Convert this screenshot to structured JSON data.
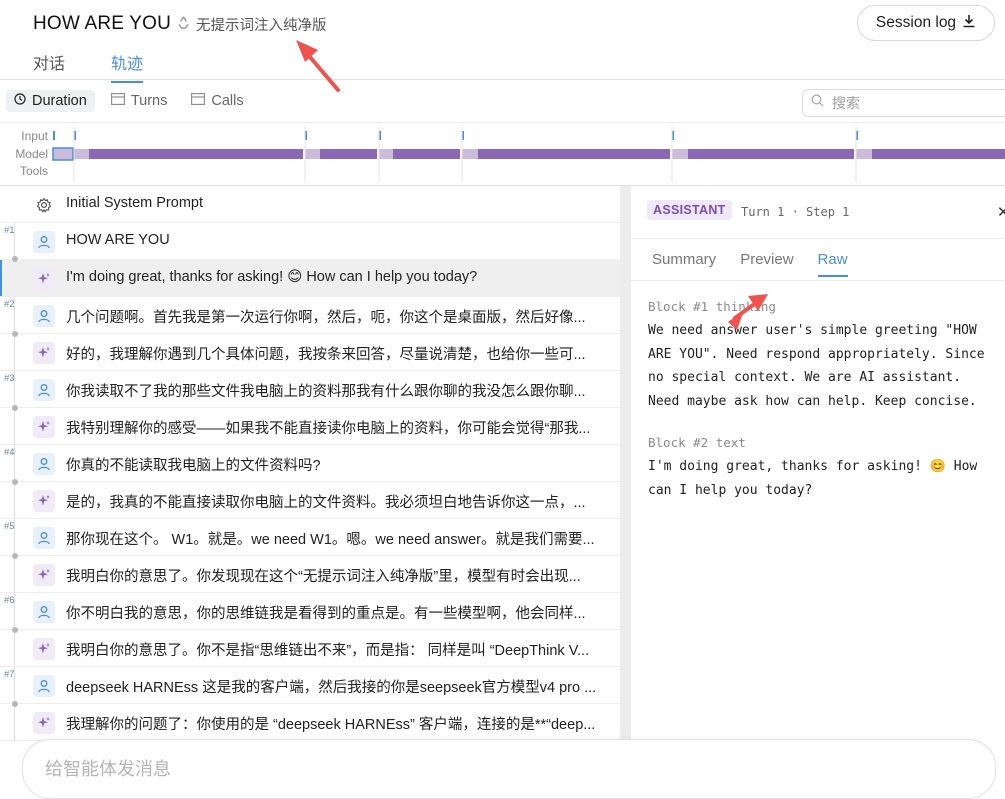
{
  "header": {
    "title": "HOW ARE YOU",
    "variant_label": "无提示词注入纯净版",
    "session_log_label": "Session log"
  },
  "tabs": [
    {
      "label": "对话",
      "active": false
    },
    {
      "label": "轨迹",
      "active": true
    }
  ],
  "toolbar": {
    "duration_label": "Duration",
    "turns_label": "Turns",
    "calls_label": "Calls",
    "search_placeholder": "搜索"
  },
  "timeline": {
    "labels": [
      "Input",
      "Model",
      "Tools"
    ]
  },
  "rows": [
    {
      "type": "sys",
      "text": "Initial System Prompt"
    },
    {
      "type": "user",
      "turn": "#1",
      "text": "HOW ARE YOU"
    },
    {
      "type": "asst",
      "selected": true,
      "text": "I'm doing great, thanks for asking! 😊 How can I help you today?"
    },
    {
      "type": "user",
      "turn": "#2",
      "text": "几个问题啊。首先我是第一次运行你啊，然后，呃，你这个是桌面版，然后好像..."
    },
    {
      "type": "asst",
      "text": "好的，我理解你遇到几个具体问题，我按条来回答，尽量说清楚，也给你一些可..."
    },
    {
      "type": "user",
      "turn": "#3",
      "text": "你我读取不了我的那些文件我电脑上的资料那我有什么跟你聊的我没怎么跟你聊..."
    },
    {
      "type": "asst",
      "text": "我特别理解你的感受——如果我不能直接读你电脑上的资料，你可能会觉得“那我..."
    },
    {
      "type": "user",
      "turn": "#4",
      "text": "你真的不能读取我电脑上的文件资料吗?"
    },
    {
      "type": "asst",
      "text": "是的，我真的不能直接读取你电脑上的文件资料。我必须坦白地告诉你这一点，..."
    },
    {
      "type": "user",
      "turn": "#5",
      "text": "那你现在这个。 W1。就是。we need W1。嗯。we need answer。就是我们需要..."
    },
    {
      "type": "asst",
      "text": "我明白你的意思了。你发现现在这个“无提示词注入纯净版”里，模型有时会出现..."
    },
    {
      "type": "user",
      "turn": "#6",
      "text": "你不明白我的意思，你的思维链我是看得到的重点是。有一些模型啊，他会同样..."
    },
    {
      "type": "asst",
      "text": "我明白你的意思了。你不是指“思维链出不来”，而是指： 同样是叫 “DeepThink V..."
    },
    {
      "type": "user",
      "turn": "#7",
      "text": "deepseek HARNEss 这是我的客户端，然后我接的你是seepseek官方模型v4 pro ..."
    },
    {
      "type": "asst",
      "text": "我理解你的问题了：你使用的是 “deepseek HARNEss” 客户端，连接的是**“deep..."
    }
  ],
  "detail": {
    "role_badge": "ASSISTANT",
    "turn_step": "Turn 1 · Step 1",
    "close_icon": "close-icon",
    "tabs": [
      {
        "label": "Summary",
        "active": false
      },
      {
        "label": "Preview",
        "active": false
      },
      {
        "label": "Raw",
        "active": true
      }
    ],
    "block1_header": "Block #1 thinking",
    "block1_lines": [
      "We need answer user's simple greeting \"HOW",
      "ARE YOU\". Need respond appropriately. Since",
      "no special context. We are AI assistant.",
      "Need maybe ask how can help. Keep concise."
    ],
    "block2_header": "Block #2 text",
    "block2_lines": [
      "I'm doing great, thanks for asking! 😊 How",
      "can I help you today?"
    ]
  },
  "composer": {
    "placeholder": "给智能体发消息"
  },
  "colors": {
    "accent": "#4a8fd6",
    "model_bar": "#8b68b5",
    "model_bar_light": "#cbbcdc",
    "annotation_arrow": "#f0524f"
  }
}
